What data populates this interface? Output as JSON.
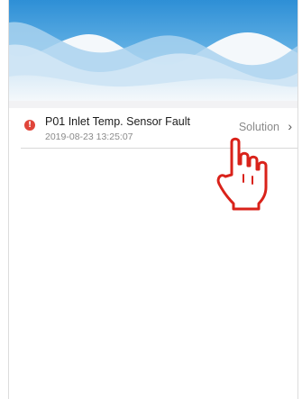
{
  "fault_list": {
    "items": [
      {
        "icon": "exclamation-circle-icon",
        "icon_glyph": "!",
        "title": "P01 Inlet Temp. Sensor Fault",
        "timestamp": "2019-08-23 13:25:07",
        "action_label": "Solution",
        "chevron": "›"
      }
    ]
  },
  "colors": {
    "alert_red": "#e0453a",
    "wave_blue": "#3a9ad9",
    "cursor_red": "#d9221a"
  },
  "icons": {
    "header": "wave-header-graphic",
    "pointer": "hand-pointer-icon"
  }
}
